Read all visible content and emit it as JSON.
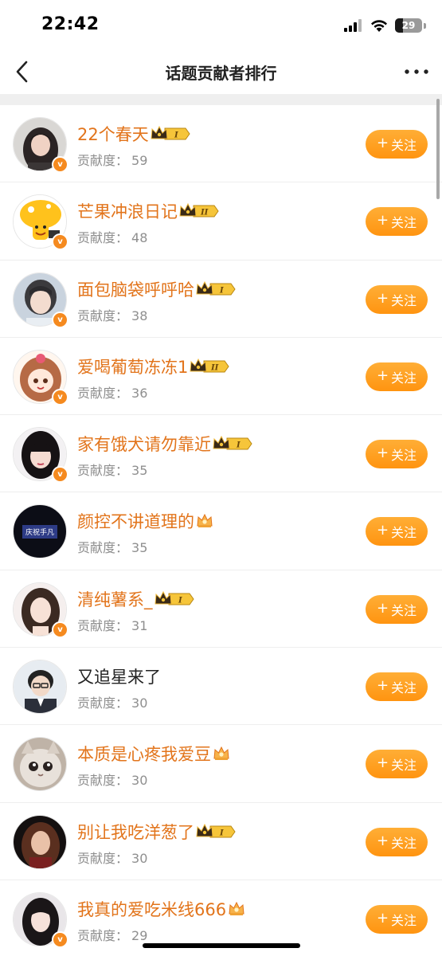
{
  "status_bar": {
    "time": "22:42",
    "battery": "29",
    "battery_level_percent": 29
  },
  "nav": {
    "title": "话题贡献者排行"
  },
  "score_label": "贡献度：",
  "follow_label": "关注",
  "follow_icon": "+",
  "contributors": [
    {
      "name": "22个春天",
      "score": "59",
      "badge": "crown-level-1",
      "name_color": "orange"
    },
    {
      "name": "芒果冲浪日记",
      "score": "48",
      "badge": "crown-level-2",
      "name_color": "orange"
    },
    {
      "name": "面包脑袋呼呼哈",
      "score": "38",
      "badge": "crown-level-1",
      "name_color": "orange"
    },
    {
      "name": "爱喝葡萄冻冻1",
      "score": "36",
      "badge": "crown-level-2",
      "name_color": "orange"
    },
    {
      "name": "家有饿犬请勿靠近",
      "score": "35",
      "badge": "crown-level-1",
      "name_color": "orange"
    },
    {
      "name": "颜控不讲道理的",
      "score": "35",
      "badge": "crown-small",
      "name_color": "orange"
    },
    {
      "name": "清纯薯系_",
      "score": "31",
      "badge": "crown-level-1",
      "name_color": "orange"
    },
    {
      "name": "又追星来了",
      "score": "30",
      "badge": "none",
      "name_color": "black"
    },
    {
      "name": "本质是心疼我爱豆",
      "score": "30",
      "badge": "crown-small",
      "name_color": "orange"
    },
    {
      "name": "别让我吃洋葱了",
      "score": "30",
      "badge": "crown-level-1",
      "name_color": "orange"
    },
    {
      "name": "我真的爱吃米线666",
      "score": "29",
      "badge": "crown-small",
      "name_color": "orange"
    }
  ],
  "avatar_text": {
    "row6": "庆祝手凡"
  },
  "colors": {
    "accent": "#ff9a1f",
    "name_orange": "#e2741b",
    "score_gray": "#8f8f8f",
    "verified_badge": "#f58a1f"
  }
}
